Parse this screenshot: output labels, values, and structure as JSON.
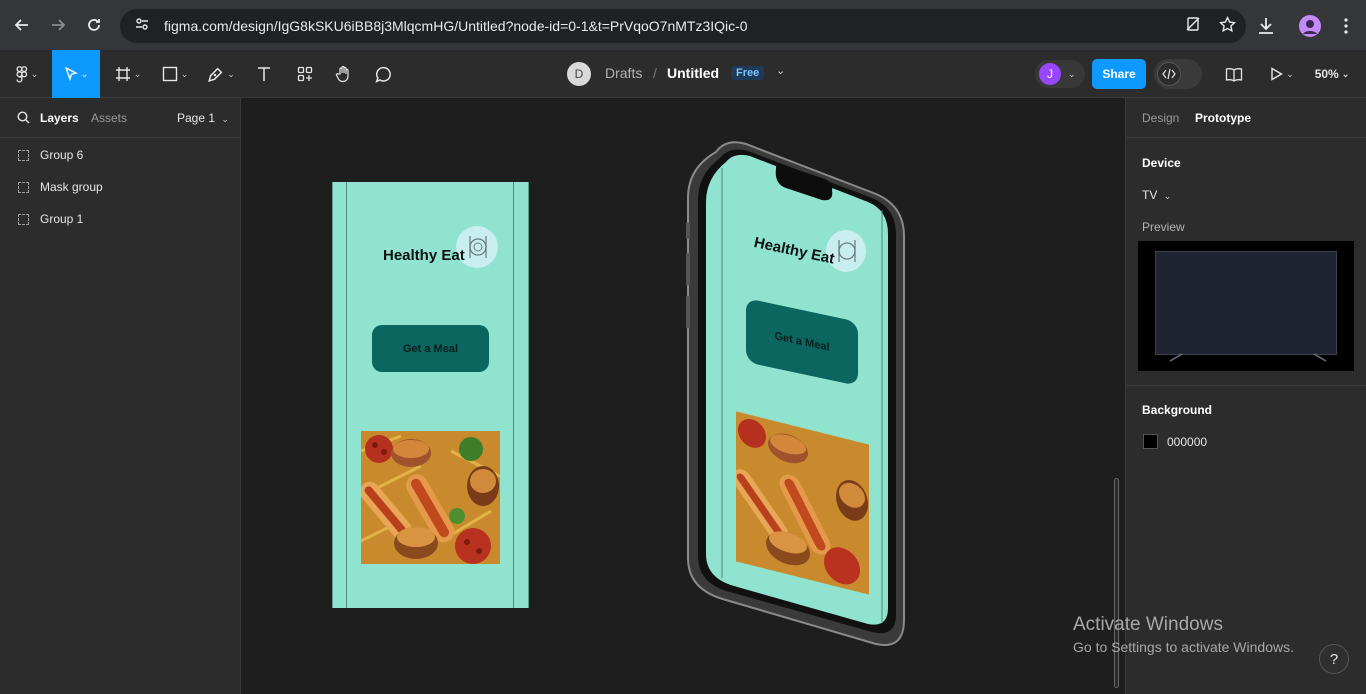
{
  "browser": {
    "url": "figma.com/design/IgG8kSKU6iBB8j3MlqcmHG/Untitled?node-id=0-1&t=PrVqoO7nMTz3IQic-0"
  },
  "toolbar": {
    "avatar_initial": "D",
    "breadcrumb_root": "Drafts",
    "breadcrumb_sep": "/",
    "file_name": "Untitled",
    "plan_badge": "Free",
    "user_initial": "J",
    "share_label": "Share",
    "zoom": "50%"
  },
  "left_panel": {
    "tab_layers": "Layers",
    "tab_assets": "Assets",
    "page_selector": "Page 1",
    "layers": [
      "Group 6",
      "Mask group",
      "Group 1"
    ]
  },
  "canvas": {
    "app_title": "Healthy Eat",
    "button_label": "Get a Meal"
  },
  "right_panel": {
    "tab_design": "Design",
    "tab_prototype": "Prototype",
    "device_heading": "Device",
    "device_value": "TV",
    "preview_label": "Preview",
    "background_heading": "Background",
    "background_value": "000000"
  },
  "overlay": {
    "activate_title": "Activate Windows",
    "activate_sub": "Go to Settings to activate Windows.",
    "help": "?"
  },
  "colors": {
    "accent_blue": "#0d99ff",
    "mint": "#8fe3cf",
    "teal_button": "#0b6660",
    "user_purple": "#9747ff"
  }
}
